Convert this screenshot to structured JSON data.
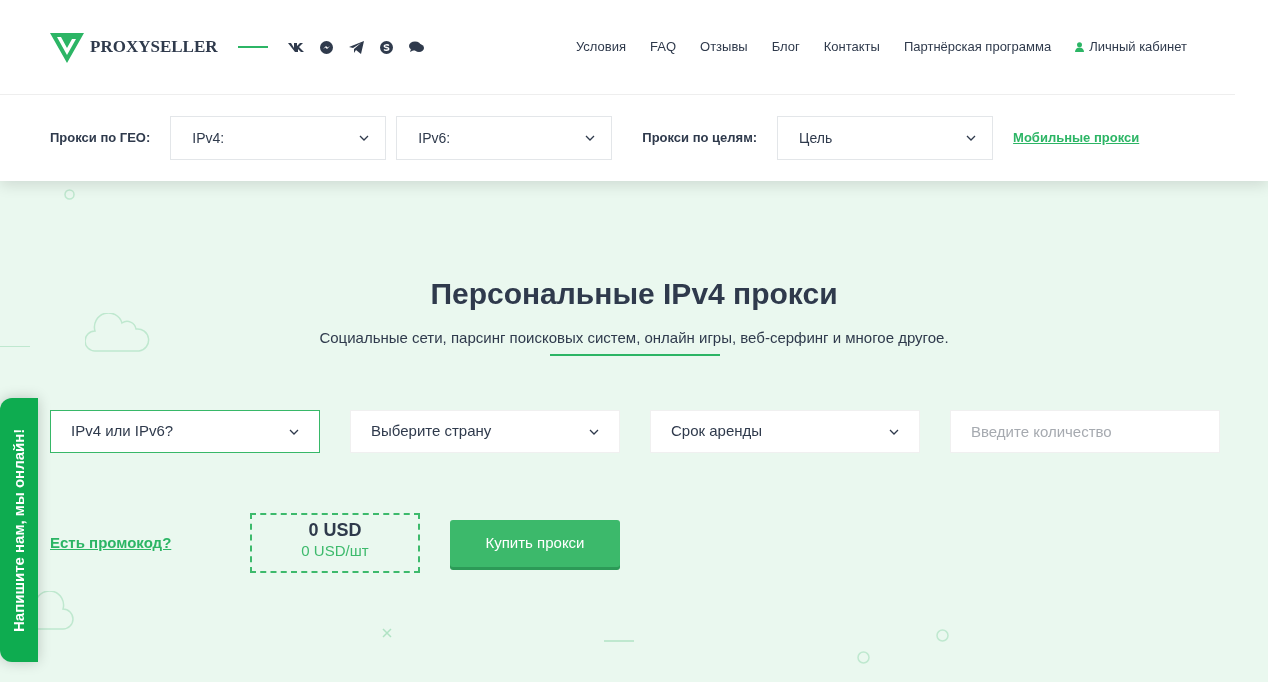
{
  "header": {
    "logo_text": "PROXYSELLER",
    "nav": [
      {
        "label": "Условия",
        "kind": "link"
      },
      {
        "label": "FAQ",
        "kind": "link"
      },
      {
        "label": "Отзывы",
        "kind": "link"
      },
      {
        "label": "Блог",
        "kind": "link"
      },
      {
        "label": "Контакты",
        "kind": "link"
      },
      {
        "label": "Партнёрская программа",
        "kind": "link"
      },
      {
        "label": "Личный кабинет",
        "kind": "account"
      }
    ],
    "filters": [
      {
        "kind": "label",
        "text": "Прокси по ГЕО:"
      },
      {
        "kind": "select",
        "text": "IPv4:"
      },
      {
        "kind": "select",
        "text": "IPv6:"
      },
      {
        "kind": "label",
        "text": "Прокси по целям:"
      },
      {
        "kind": "select",
        "text": "Цель"
      },
      {
        "kind": "link",
        "text": "Мобильные прокси"
      }
    ]
  },
  "hero": {
    "title": "Персональные IPv4 прокси",
    "subtitle": "Социальные сети, парсинг поисковых систем, онлайн игры, веб-серфинг и многое другое.",
    "fields": [
      {
        "kind": "select",
        "text": "IPv4 или IPv6?",
        "focused": true
      },
      {
        "kind": "select",
        "text": "Выберите страну",
        "focused": false
      },
      {
        "kind": "select",
        "text": "Срок аренды",
        "focused": false
      },
      {
        "kind": "input",
        "placeholder": "Введите количество",
        "focused": false
      }
    ],
    "promo_link": "Есть промокод?",
    "price_total": "0 USD",
    "price_unit": "0 USD/шт",
    "buy_button": "Купить прокси"
  },
  "chat_tab": "Напишите нам, мы онлайн!"
}
